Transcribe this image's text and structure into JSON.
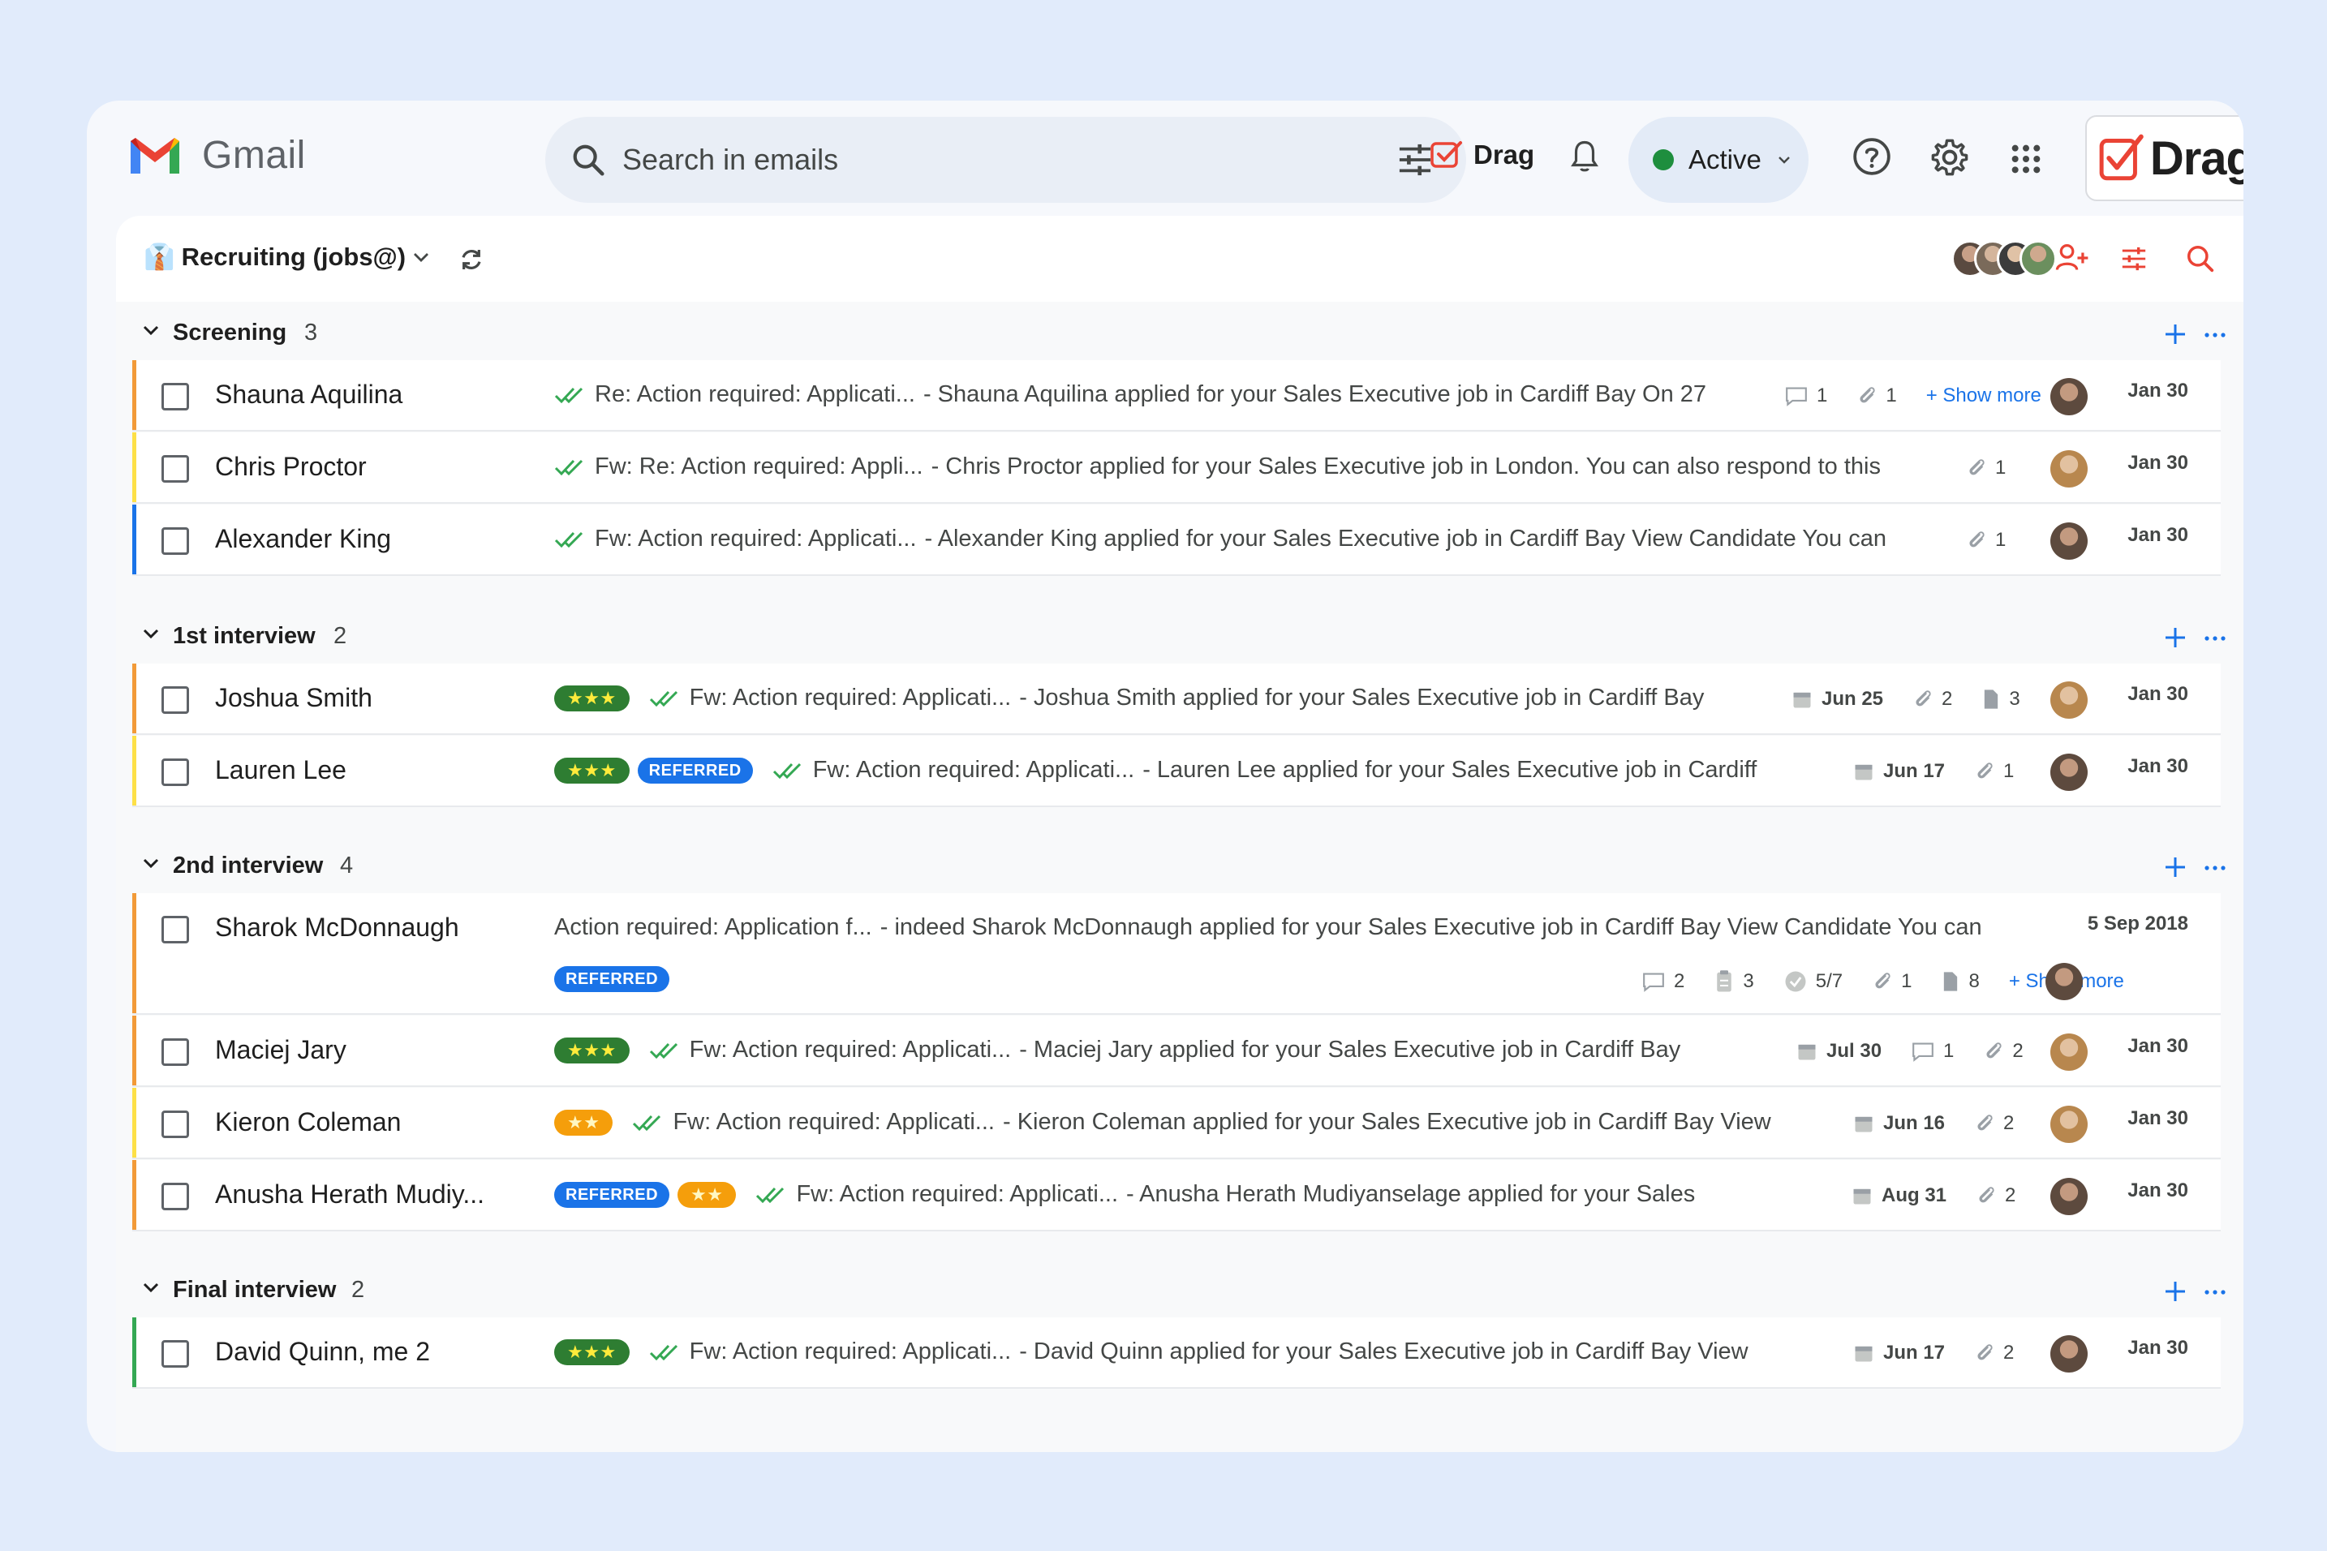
{
  "app": {
    "name": "Gmail"
  },
  "search": {
    "placeholder": "Search in emails"
  },
  "toolbar": {
    "drag_label": "Drag",
    "status_label": "Active",
    "brand_label": "Drag"
  },
  "board": {
    "title": "Recruiting (jobs@)",
    "title_emoji": "👔"
  },
  "colors": {
    "orange": "#f29a38",
    "yellow": "#fde047",
    "blue": "#1a73e8",
    "green": "#34a853",
    "brand_red": "#ea4335"
  },
  "groups": [
    {
      "name": "Screening",
      "count": "3"
    },
    {
      "name": "1st interview",
      "count": "2"
    },
    {
      "name": "2nd interview",
      "count": "4"
    },
    {
      "name": "Final interview",
      "count": "2"
    }
  ],
  "rows": [
    {
      "name": "Shauna Aquilina",
      "subject": "Re: Action required: Applicati...",
      "snippet": "- Shauna Aquilina applied for your Sales Executive job in Cardiff Bay On 27",
      "comments": "1",
      "attachments": "1",
      "show_more": "+ Show more",
      "date": "Jan 30"
    },
    {
      "name": "Chris Proctor",
      "subject": "Fw: Re: Action required: Appli...",
      "snippet": "- Chris Proctor applied for your Sales Executive job in London. You can also respond to this",
      "attachments": "1",
      "date": "Jan 30"
    },
    {
      "name": "Alexander King",
      "subject": "Fw: Action required: Applicati...",
      "snippet": "- Alexander King applied for your Sales Executive job in Cardiff Bay View Candidate You can",
      "attachments": "1",
      "date": "Jan 30"
    },
    {
      "name": "Joshua Smith",
      "stars": "★★★",
      "subject": "Fw: Action required: Applicati...",
      "snippet": "- Joshua Smith applied for your Sales Executive job in Cardiff Bay",
      "due": "Jun 25",
      "attachments": "2",
      "files": "3",
      "date": "Jan 30"
    },
    {
      "name": "Lauren Lee",
      "stars": "★★★",
      "tag": "REFERRED",
      "subject": "Fw: Action required: Applicati...",
      "snippet": "- Lauren Lee applied for your Sales Executive job in Cardiff",
      "due": "Jun 17",
      "attachments": "1",
      "date": "Jan 30"
    },
    {
      "name": "Sharok McDonnaugh",
      "subject": "Action required: Application f...",
      "snippet": "- indeed Sharok McDonnaugh applied for your Sales Executive job in Cardiff Bay View Candidate You can",
      "tag": "REFERRED",
      "comments": "2",
      "tasks": "3",
      "progress": "5/7",
      "attachments": "1",
      "files": "8",
      "show_more": "+ Show more",
      "date": "5 Sep 2018"
    },
    {
      "name": "Maciej Jary",
      "stars": "★★★",
      "subject": "Fw: Action required: Applicati...",
      "snippet": "- Maciej Jary applied for your Sales Executive job in Cardiff Bay",
      "due": "Jul 30",
      "comments": "1",
      "attachments": "2",
      "date": "Jan 30"
    },
    {
      "name": "Kieron Coleman",
      "stars": "★★",
      "subject": "Fw: Action required: Applicati...",
      "snippet": "- Kieron Coleman applied for your Sales Executive job in Cardiff Bay View",
      "due": "Jun 16",
      "attachments": "2",
      "date": "Jan 30"
    },
    {
      "name": "Anusha Herath Mudiy...",
      "tag": "REFERRED",
      "stars": "★★",
      "subject": "Fw: Action required: Applicati...",
      "snippet": "- Anusha Herath Mudiyanselage applied for your Sales",
      "due": "Aug 31",
      "attachments": "2",
      "date": "Jan 30"
    },
    {
      "name": "David Quinn, me 2",
      "stars": "★★★",
      "subject": "Fw: Action required: Applicati...",
      "snippet": "- David Quinn applied for your Sales Executive job in Cardiff Bay View",
      "due": "Jun 17",
      "attachments": "2",
      "date": "Jan 30"
    }
  ]
}
